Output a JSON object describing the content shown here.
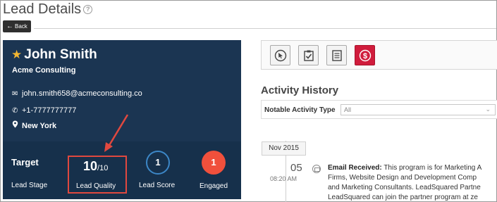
{
  "header": {
    "title": "Lead Details",
    "back_label": "Back"
  },
  "lead": {
    "name": "John Smith",
    "company": "Acme Consulting",
    "email": "john.smith658@acmeconsulting.co",
    "phone": "+1-7777777777",
    "location": "New York",
    "starred": true
  },
  "metrics": {
    "target_label": "Target",
    "stage_label": "Lead Stage",
    "quality_value": "10",
    "quality_max": "/10",
    "quality_label": "Lead Quality",
    "score_value": "1",
    "score_label": "Lead Score",
    "engaged_value": "1",
    "engaged_label": "Engaged"
  },
  "toolbar": {
    "buttons": [
      "cursor-icon",
      "task-checklist-icon",
      "notes-icon",
      "dollar-icon"
    ]
  },
  "activity": {
    "title": "Activity History",
    "filter_label": "Notable Activity Type",
    "filter_value": "All",
    "month": "Nov 2015",
    "day": "05",
    "time": "08:20 AM",
    "entry_title": "Email Received:",
    "entry_lines": [
      " This program is for Marketing A",
      "Firms, Website Design and Development Comp",
      "and Marketing Consultants. LeadSquared Partne",
      "LeadSquared can join the partner program at ze"
    ]
  },
  "colors": {
    "card_bg": "#1b3552",
    "highlight_border": "#e0483f",
    "engaged_fill": "#f0503c",
    "score_ring": "#3c87c7",
    "star": "#f2b632",
    "dollar_button": "#d01c3c"
  }
}
